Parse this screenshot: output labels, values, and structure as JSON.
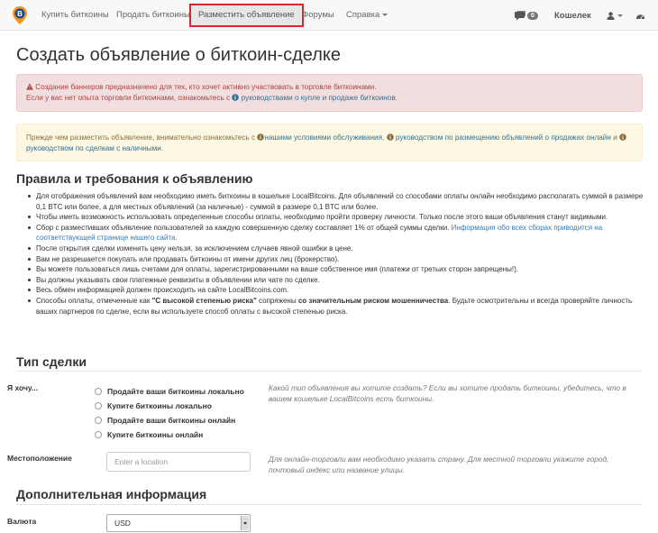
{
  "nav": {
    "buy": "Купить биткоины",
    "sell": "Продать биткоины",
    "post_ad": "Разместить объявление",
    "forums": "Форумы",
    "help": "Справка",
    "messages_count": "0",
    "wallet": "Кошелек"
  },
  "page_title": "Создать объявление о биткоин-сделке",
  "danger_alert": {
    "line1": "Создание баннеров предназначено для тех, кто хочет активно участвовать в торговле биткоинами.",
    "line2_prefix": "Если у вас нет опыта торговли биткоинами, ознакомьтесь с",
    "line2_link": "руководствами о купле и продаже биткоинов",
    "line2_suffix": "."
  },
  "warning_alert": {
    "prefix": "Прежде чем разместить объявление, внимательно ознакомьтесь с",
    "link1": "нашими условиями обслуживания",
    "sep1": ",",
    "link2": "руководством по размещению объявлений о продажах онлайн",
    "conj": "и",
    "link3": "руководством по сделкам с наличными",
    "suffix": "."
  },
  "rules_title": "Правила и требования к объявлению",
  "rules": {
    "r1": "Для отображения объявлений вам необходимо иметь биткоины в кошельке LocalBitcoins. Для объявлений со способами оплаты онлайн необходимо располагать суммой в размере 0,1 BTC или более, а для местных объявлений (за наличные) - суммой в размере 0,1 BTC или более.",
    "r2": "Чтобы иметь возможность использовать определенные способы оплаты, необходимо пройти проверку личности. Только после этого ваши объявления станут видимыми.",
    "r3_text": "Сбор с разместивших объявление пользователей за каждую совершенную сделку составляет 1% от общей суммы сделки.",
    "r3_link": "Информация обо всех сборах приводится на соответствующей странице нашего сайта.",
    "r4": "После открытия сделки изменить цену нельзя, за исключением случаев явной ошибки в цене.",
    "r5": "Вам не разрешается покупать или продавать биткоины от имени других лиц (брокерство).",
    "r6": "Вы можете пользоваться лишь счетами для оплаты, зарегистрированными на ваше собственное имя (платежи от третьих сторон запрещены!).",
    "r7": "Вы должны указывать свои платежные реквизиты в объявлении или чате по сделке.",
    "r8": "Весь обмен информацией должен происходить на сайте LocalBitcoins.com.",
    "r9_a": "Способы оплаты, отмеченные как",
    "r9_b": "\"С высокой степенью риска\"",
    "r9_c": "сопряжены",
    "r9_d": "со значительным риском мошенничества",
    "r9_e": ". Будьте осмотрительны и всегда проверяйте личность ваших партнеров по сделке, если вы используете способ оплаты с высокой степенью риска."
  },
  "trade_type": {
    "title": "Тип сделки",
    "label": "Я хочу...",
    "options": {
      "o1": "Продайте ваши биткоины локально",
      "o2": "Купите биткоины локально",
      "o3": "Продайте ваши биткоины онлайн",
      "o4": "Купите биткоины онлайн"
    },
    "help": "Какой тип объявления вы хотите создать? Если вы хотите продать биткоины, убедитесь, что в вашем кошельке LocalBitcoins есть биткоины."
  },
  "location": {
    "label": "Местоположение",
    "placeholder": "Enter a location",
    "help": "Для онлайн-торговли вам необходимо указать страну. Для местной торговли укажите город, почтовый индекс или название улицы."
  },
  "additional": {
    "title": "Дополнительная информация",
    "currency_label": "Валюта",
    "currency_value": "USD"
  },
  "colors": {
    "accent_red": "#d9272e",
    "link": "#337ab7",
    "danger_bg": "#f2dede",
    "warning_bg": "#fcf8e3"
  }
}
